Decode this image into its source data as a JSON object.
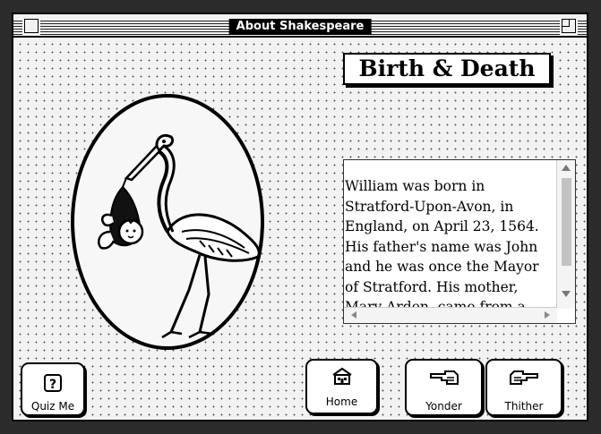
{
  "window": {
    "title": "About Shakespeare"
  },
  "main": {
    "heading": "Birth & Death",
    "body_text": "William was born in Stratford-Upon-Avon, in England, on April 23, 1564. His father's name was John and he was once the Mayor of Stratford. His mother, Mary Arden, came from a very wealthy family. He was buried on April"
  },
  "buttons": {
    "quiz": {
      "label": "Quiz Me",
      "icon": "question-mark-icon"
    },
    "home": {
      "label": "Home",
      "icon": "house-icon"
    },
    "yonder": {
      "label": "Yonder",
      "icon": "pointing-hand-left-icon"
    },
    "thither": {
      "label": "Thither",
      "icon": "pointing-hand-right-icon"
    }
  },
  "illustration": {
    "subject": "stork-carrying-baby"
  }
}
